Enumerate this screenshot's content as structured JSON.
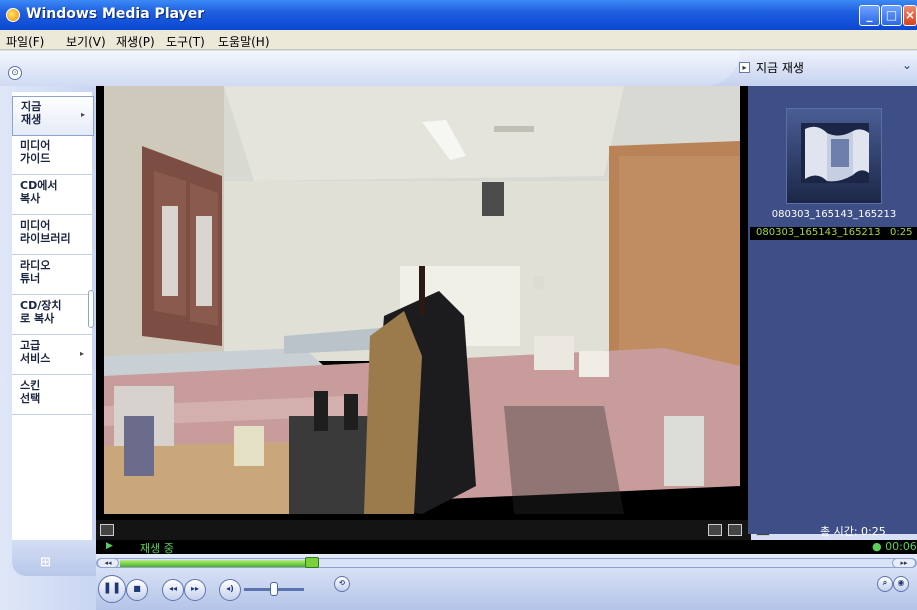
{
  "window": {
    "title": "Windows Media Player"
  },
  "menu": [
    {
      "label": "파일(F)"
    },
    {
      "label": "보기(V)"
    },
    {
      "label": "재생(P)"
    },
    {
      "label": "도구(T)"
    },
    {
      "label": "도움말(H)"
    }
  ],
  "now_playing_selector": {
    "label": "지금 재생"
  },
  "sidebar": {
    "items": [
      {
        "label": "지금\n재생",
        "has_arrow": true,
        "active": true
      },
      {
        "label": "미디어\n가이드",
        "has_arrow": false
      },
      {
        "label": "CD에서\n복사",
        "has_arrow": false
      },
      {
        "label": "미디어\n라이브러리",
        "has_arrow": false
      },
      {
        "label": "라디오\n튜너",
        "has_arrow": false
      },
      {
        "label": "CD/장치\n로 복사",
        "has_arrow": false
      },
      {
        "label": "고급\n서비스",
        "has_arrow": true
      },
      {
        "label": "스킨\n선택",
        "has_arrow": false
      }
    ]
  },
  "playlist": {
    "thumbnail_caption": "080303_165143_165213",
    "items": [
      {
        "name": "080303_165143_165213",
        "duration": "0:25"
      }
    ],
    "total_time": "총 시간: 0:25"
  },
  "playback": {
    "status": "재생 중",
    "elapsed": "00:06",
    "progress": 0.24,
    "volume": 0.5
  },
  "colors": {
    "title_bar": "#0a47d2",
    "accent_green": "#5ad05a",
    "playlist_bg": "#3d4f86"
  }
}
